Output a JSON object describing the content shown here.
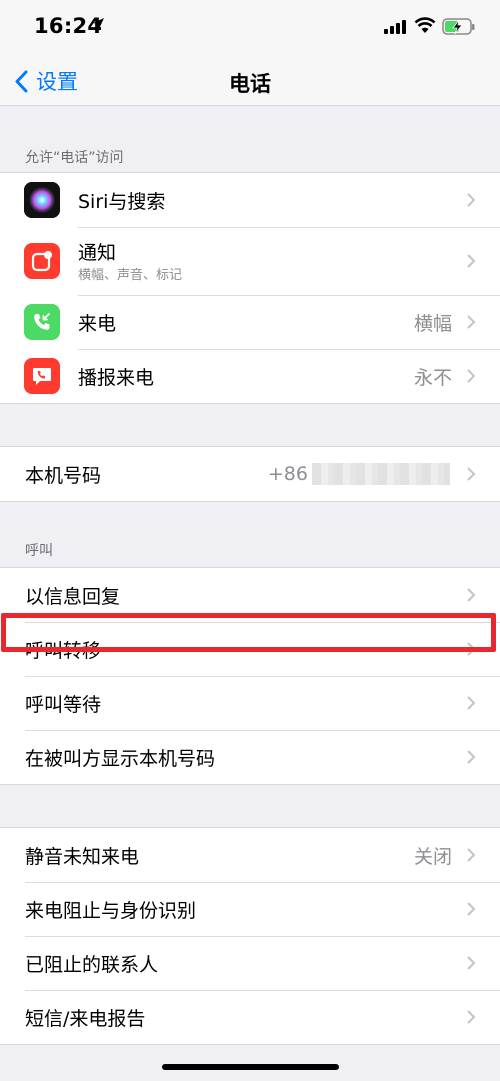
{
  "status_bar": {
    "time": "16:24"
  },
  "nav": {
    "back_label": "设置",
    "title": "电话"
  },
  "section_access": {
    "header": "允许“电话”访问",
    "rows": [
      {
        "label": "Siri与搜索",
        "icon": "siri-icon"
      },
      {
        "label": "通知",
        "sublabel": "横幅、声音、标记",
        "icon": "notifications-icon",
        "icon_color": "#ff3b30"
      },
      {
        "label": "来电",
        "value": "横幅",
        "icon": "incoming-call-icon",
        "icon_color": "#4cd964"
      },
      {
        "label": "播报来电",
        "value": "永不",
        "icon": "announce-calls-icon",
        "icon_color": "#ff3b30"
      }
    ]
  },
  "my_number": {
    "label": "本机号码",
    "value_prefix": "+86"
  },
  "section_calls": {
    "header": "呼叫",
    "rows": [
      {
        "label": "以信息回复"
      },
      {
        "label": "呼叫转移"
      },
      {
        "label": "呼叫等待"
      },
      {
        "label": "在被叫方显示本机号码"
      }
    ]
  },
  "section_blocking": {
    "rows": [
      {
        "label": "静音未知来电",
        "value": "关闭"
      },
      {
        "label": "来电阻止与身份识别"
      },
      {
        "label": "已阻止的联系人"
      },
      {
        "label": "短信/来电报告"
      }
    ]
  },
  "colors": {
    "accent": "#007aff",
    "highlight": "#e8282e"
  }
}
